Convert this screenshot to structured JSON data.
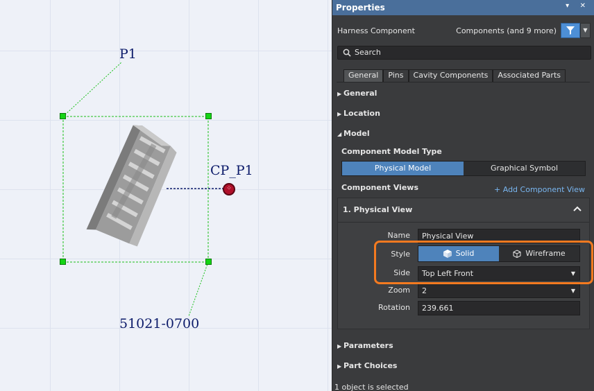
{
  "canvas": {
    "designator": "P1",
    "cavity_label": "CP_P1",
    "part_number": "51021-0700",
    "cavity_pin_symbol": "⁘"
  },
  "panel": {
    "title": "Properties",
    "header_buttons": "▾ ✕",
    "object_type": "Harness Component",
    "filter_text": "Components (and 9 more)",
    "search_placeholder": "Search",
    "tabs": [
      {
        "label": "General",
        "active": true
      },
      {
        "label": "Pins",
        "active": false
      },
      {
        "label": "Cavity Components",
        "active": false
      },
      {
        "label": "Associated Parts",
        "active": false
      }
    ],
    "sections": {
      "general": "General",
      "location": "Location",
      "model": "Model",
      "parameters": "Parameters",
      "part_choices": "Part Choices"
    },
    "model": {
      "type_heading": "Component Model Type",
      "type_options": [
        "Physical Model",
        "Graphical Symbol"
      ],
      "selected_type": "Physical Model",
      "views_heading": "Component Views",
      "add_view_link": "+ Add Component View",
      "view_title": "1. Physical View",
      "name_label": "Name",
      "name_value": "Physical View",
      "style_label": "Style",
      "style_options": [
        "Solid",
        "Wireframe"
      ],
      "selected_style": "Solid",
      "side_label": "Side",
      "side_value": "Top Left Front",
      "zoom_label": "Zoom",
      "zoom_value": "2",
      "rotation_label": "Rotation",
      "rotation_value": "239.661"
    },
    "status": "1 object is selected"
  },
  "colors": {
    "accent": "#4e83bb",
    "header": "#4a6f9b",
    "highlight": "#f47a20",
    "selection": "#15d415",
    "label_text": "#0c1b6a"
  }
}
